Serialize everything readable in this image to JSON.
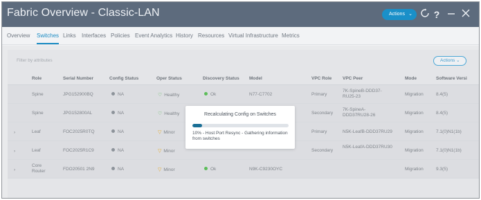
{
  "window": {
    "title": "Fabric Overview - Classic-LAN",
    "actions_label": "Actions",
    "refresh_icon": "refresh-icon",
    "help_icon": "help-icon",
    "minimize_icon": "minimize-icon",
    "close_icon": "close-icon"
  },
  "tabs": [
    {
      "label": "Overview",
      "active": false
    },
    {
      "label": "Switches",
      "active": true
    },
    {
      "label": "Links",
      "active": false
    },
    {
      "label": "Interfaces",
      "active": false
    },
    {
      "label": "Policies",
      "active": false
    },
    {
      "label": "Event Analytics",
      "active": false
    },
    {
      "label": "History",
      "active": false
    },
    {
      "label": "Resources",
      "active": false
    },
    {
      "label": "Virtual Infrastructure",
      "active": false
    },
    {
      "label": "Metrics",
      "active": false
    }
  ],
  "toolbar": {
    "filter_placeholder": "Filter by attributes",
    "actions_label": "Actions"
  },
  "table": {
    "headers": [
      "Role",
      "Serial Number",
      "Config Status",
      "Oper Status",
      "Discovery Status",
      "Model",
      "VPC Role",
      "VPC Peer",
      "Mode",
      "Software Versi"
    ],
    "rows": [
      {
        "expand": "",
        "role": "Spine",
        "serial": "JPG152900BQ",
        "config": "NA",
        "oper": "Healthy",
        "oper_state": "healthy",
        "discovery": "Ok",
        "model": "N77-C7702",
        "vpc_role": "Primary",
        "vpc_peer": "7K-SpineB-DDD37-RU25-23",
        "mode": "Migration",
        "software": "8.4(5)"
      },
      {
        "expand": "",
        "role": "Spine",
        "serial": "JPG152800AL",
        "config": "NA",
        "oper": "Healthy",
        "oper_state": "healthy",
        "discovery": "",
        "model": "",
        "vpc_role": "Secondary",
        "vpc_peer": "7K-SpineA-DDD37RU28-26",
        "mode": "Migration",
        "software": "8.4(5)"
      },
      {
        "expand": "›",
        "role": "Leaf",
        "serial": "FOC2025R0TQ",
        "config": "NA",
        "oper": "Minor",
        "oper_state": "minor",
        "discovery": "",
        "model": "",
        "vpc_role": "Primary",
        "vpc_peer": "N5K-LeafB-DDD37RU29",
        "mode": "Migration",
        "software": "7.1(0)N1(1b)"
      },
      {
        "expand": "›",
        "role": "Leaf",
        "serial": "FOC2025R1C9",
        "config": "NA",
        "oper": "Minor",
        "oper_state": "minor",
        "discovery": "",
        "model": "",
        "vpc_role": "Secondary",
        "vpc_peer": "N5K-LeafA-DDD37RU30",
        "mode": "Migration",
        "software": "7.1(0)N1(1b)"
      },
      {
        "expand": "›",
        "role": "Core Router",
        "serial": "FDO20501 2N9",
        "config": "NA",
        "oper": "Minor",
        "oper_state": "minor",
        "discovery": "Ok",
        "model": "N9K-C9230OYC",
        "vpc_role": "",
        "vpc_peer": "",
        "mode": "Migration",
        "software": "9.3(5)"
      }
    ]
  },
  "modal": {
    "title": "Recalculating Config on Switches",
    "progress": 0.1,
    "message": "10% - Host Port Resync - Gathering information from switches"
  }
}
